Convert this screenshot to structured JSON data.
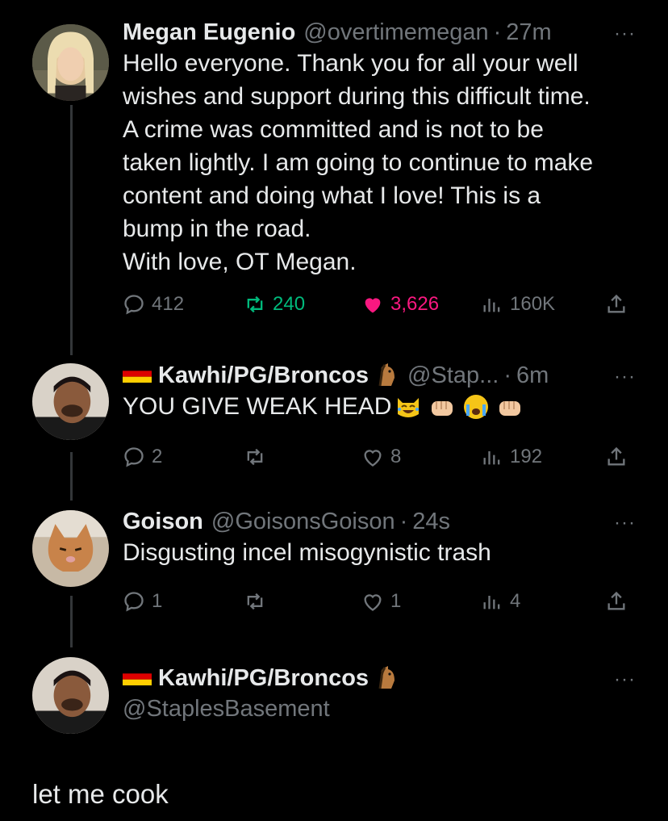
{
  "tweets": [
    {
      "name": "Megan Eugenio",
      "handle": "@overtimemegan",
      "dot": "·",
      "time": "27m",
      "more": "···",
      "text": "Hello everyone. Thank you for all your well\nwishes and support during this difficult time.\nA crime was committed and is not to be\ntaken lightly. I am going to continue to make\ncontent and doing what I love! This is a\nbump in the road.\nWith love, OT Megan.",
      "replies": "412",
      "retweets": "240",
      "likes": "3,626",
      "views": "160K"
    },
    {
      "name": "Kawhi/PG/Broncos",
      "handle": "@Stap...",
      "dot": "·",
      "time": "6m",
      "more": "···",
      "text": "YOU GIVE WEAK HEAD",
      "replies": "2",
      "retweets": "",
      "likes": "8",
      "views": "192"
    },
    {
      "name": "Goison",
      "handle": "@GoisonsGoison",
      "dot": "·",
      "time": "24s",
      "more": "···",
      "text": "Disgusting incel misogynistic trash",
      "replies": "1",
      "retweets": "",
      "likes": "1",
      "views": "4"
    }
  ],
  "composer": {
    "name": "Kawhi/PG/Broncos",
    "handle": "@StaplesBasement",
    "more": "···"
  },
  "caption": "let me cook",
  "icons": {
    "reply": "reply-icon",
    "retweet": "retweet-icon",
    "like": "heart-icon",
    "views": "views-icon",
    "share": "share-icon",
    "flag": "germany-flag-icon",
    "horse": "horse-face-icon",
    "emojis": [
      "laughing-cat-icon",
      "fist-icon",
      "crying-face-icon",
      "fist-icon"
    ]
  },
  "colors": {
    "retweet_active": "#00ba7c",
    "like_active": "#f91880",
    "muted": "#71767b"
  }
}
